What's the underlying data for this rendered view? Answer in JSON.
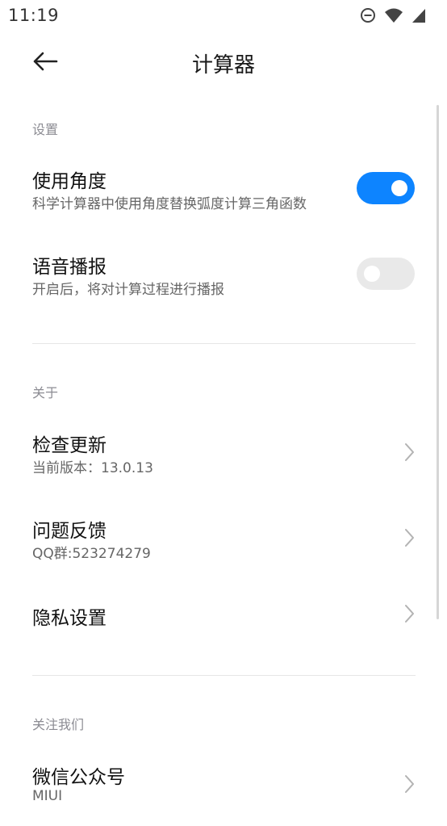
{
  "status_bar": {
    "time": "11:19",
    "icons": [
      "do-not-disturb-icon",
      "wifi-icon",
      "signal-icon"
    ]
  },
  "header": {
    "title": "计算器",
    "back_icon": "arrow-left-icon"
  },
  "sections": {
    "settings": {
      "label": "设置",
      "use_degrees": {
        "title": "使用角度",
        "subtitle": "科学计算器中使用角度替换弧度计算三角函数",
        "enabled": true
      },
      "voice": {
        "title": "语音播报",
        "subtitle": "开启后，将对计算过程进行播报",
        "enabled": false
      }
    },
    "about": {
      "label": "关于",
      "check_update": {
        "title": "检查更新",
        "subtitle": "当前版本：13.0.13"
      },
      "feedback": {
        "title": "问题反馈",
        "subtitle": "QQ群:523274279"
      },
      "privacy": {
        "title": "隐私设置"
      }
    },
    "follow": {
      "label": "关注我们",
      "wechat": {
        "title": "微信公众号",
        "subtitle": "MIUI"
      }
    }
  },
  "colors": {
    "accent": "#0d84ff",
    "toggle_off": "#e9e9e9",
    "section_label": "#8c8c93",
    "subtitle": "#666666",
    "divider": "#e6e6e6"
  }
}
